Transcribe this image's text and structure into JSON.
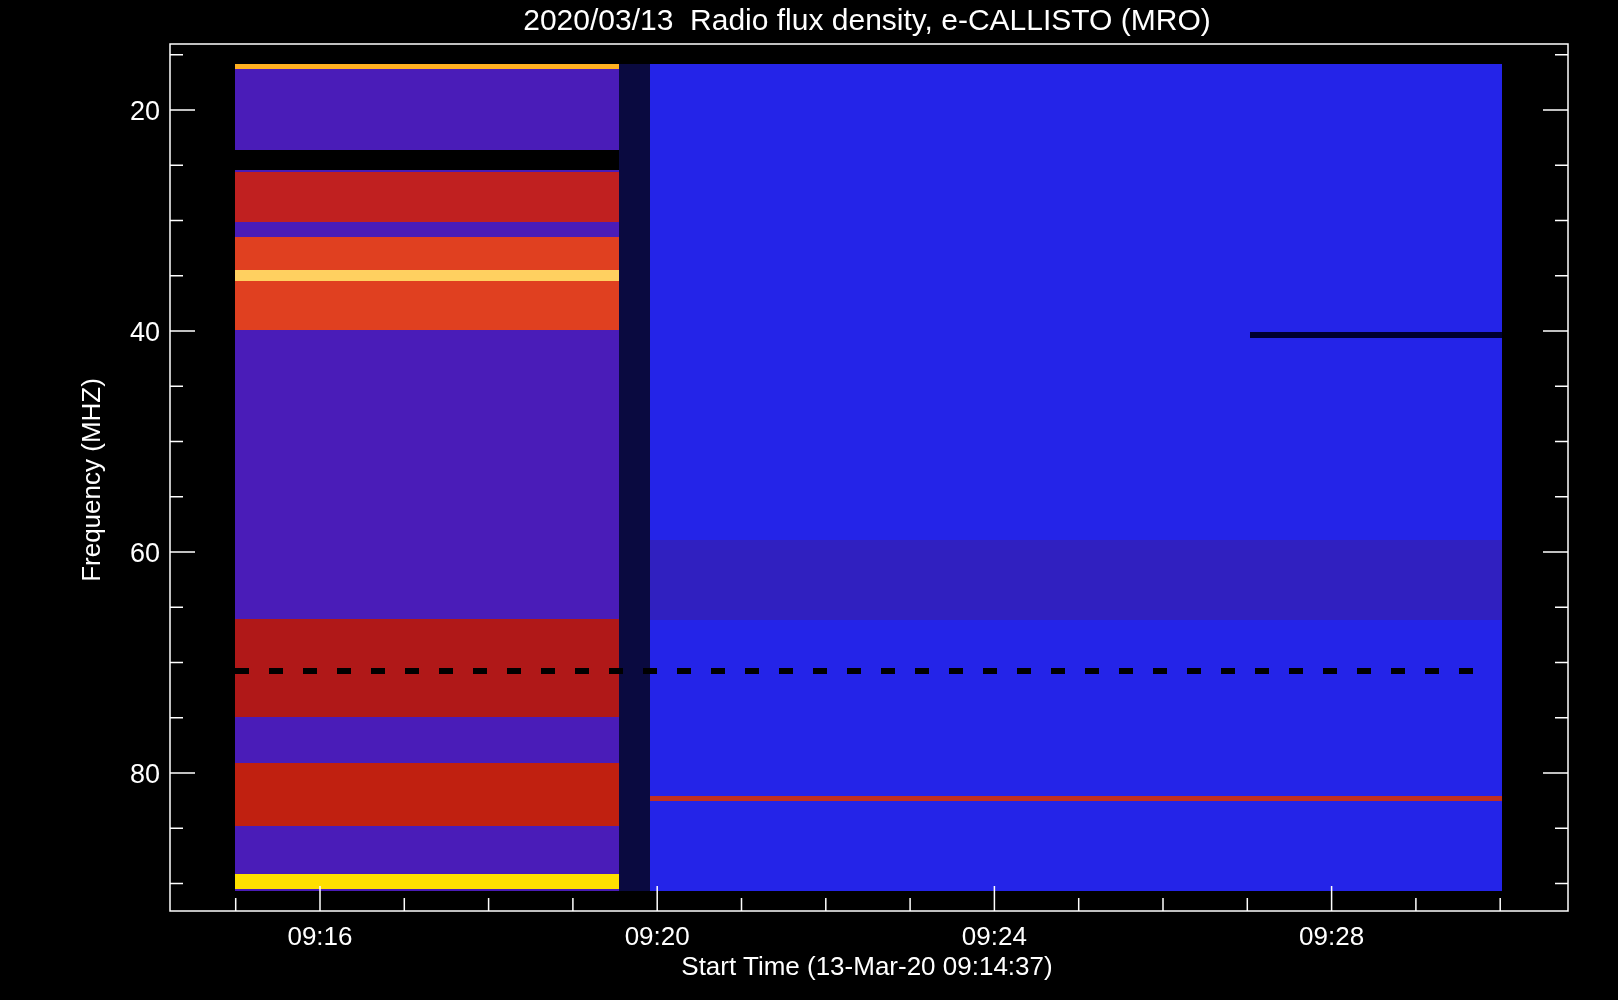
{
  "title": "2020/03/13  Radio flux density, e-CALLISTO (MRO)",
  "y_axis": {
    "label": "Frequency (MHZ)",
    "tick_labels": [
      "20",
      "40",
      "60",
      "80"
    ]
  },
  "x_axis": {
    "label": "Start Time (13-Mar-20 09:14:37)",
    "tick_labels": [
      "09:16",
      "09:20",
      "09:24",
      "09:28"
    ]
  }
}
